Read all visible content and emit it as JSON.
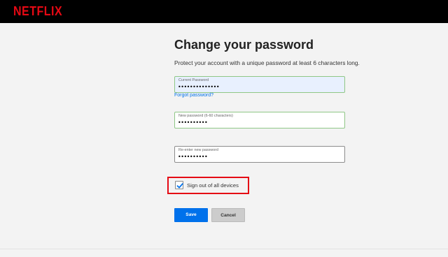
{
  "header": {
    "logo_text": "NETFLIX",
    "brand_color": "#e50914"
  },
  "page": {
    "title": "Change your password",
    "subtitle": "Protect your account with a unique password at least 6 characters long."
  },
  "form": {
    "current_password": {
      "label": "Current Password",
      "value": "••••••••••••••"
    },
    "forgot_link": "Forgot password?",
    "new_password": {
      "label": "New password (6-60 characters)",
      "value": "••••••••••"
    },
    "reenter_password": {
      "label": "Re-enter new password",
      "value": "••••••••••"
    },
    "signout_checkbox": {
      "label": "Sign out of all devices",
      "checked": true
    },
    "save_label": "Save",
    "cancel_label": "Cancel"
  },
  "colors": {
    "accent": "#0071eb",
    "highlight": "#e50914"
  }
}
